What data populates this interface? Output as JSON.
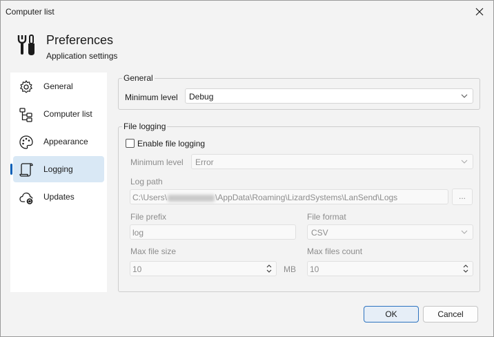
{
  "window": {
    "title": "Computer list"
  },
  "header": {
    "icon": "tools-icon",
    "title": "Preferences",
    "subtitle": "Application settings"
  },
  "sidebar": {
    "items": [
      {
        "label": "General",
        "icon": "gear-icon",
        "selected": false
      },
      {
        "label": "Computer list",
        "icon": "tree-icon",
        "selected": false
      },
      {
        "label": "Appearance",
        "icon": "palette-icon",
        "selected": false
      },
      {
        "label": "Logging",
        "icon": "scroll-icon",
        "selected": true
      },
      {
        "label": "Updates",
        "icon": "cloud-sync-icon",
        "selected": false
      }
    ]
  },
  "general_group": {
    "title": "General",
    "min_level_label": "Minimum level",
    "min_level_value": "Debug"
  },
  "file_logging": {
    "title": "File logging",
    "enable_label": "Enable file logging",
    "enabled": false,
    "min_level_label": "Minimum level",
    "min_level_value": "Error",
    "log_path_label": "Log path",
    "log_path_prefix": "C:\\Users\\",
    "log_path_suffix": "\\AppData\\Roaming\\LizardSystems\\LanSend\\Logs",
    "browse_label": "...",
    "file_prefix_label": "File prefix",
    "file_prefix_value": "log",
    "file_format_label": "File format",
    "file_format_value": "CSV",
    "max_file_size_label": "Max file size",
    "max_file_size_value": "10",
    "max_file_size_unit": "MB",
    "max_files_count_label": "Max files count",
    "max_files_count_value": "10"
  },
  "footer": {
    "ok_label": "OK",
    "cancel_label": "Cancel"
  },
  "colors": {
    "accent": "#005fb8",
    "selected_bg": "#d9e8f5"
  }
}
